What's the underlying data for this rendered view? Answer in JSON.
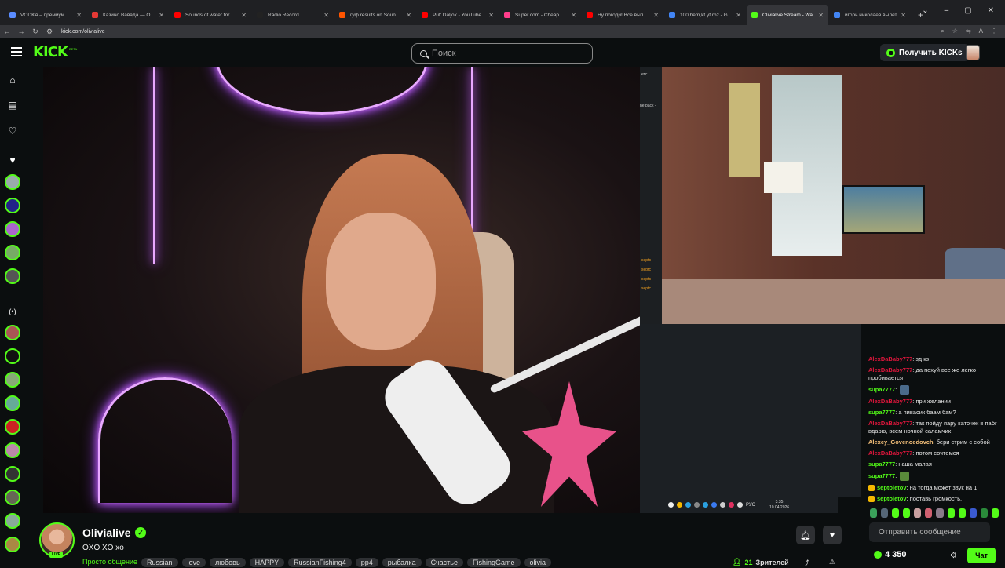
{
  "browser": {
    "tabs": [
      {
        "title": "VODKA – премиум онлайн",
        "color": "#5a8cff"
      },
      {
        "title": "Казино Вавада — Официа",
        "color": "#e53935"
      },
      {
        "title": "Sounds of water for a chi",
        "color": "#ff0000"
      },
      {
        "title": "Radio Record",
        "color": "#222222"
      },
      {
        "title": "гуф results on SoundClou",
        "color": "#ff5500"
      },
      {
        "title": "Put' Daljok - YouTube",
        "color": "#ff0000"
      },
      {
        "title": "Super.com - Cheap hotel",
        "color": "#ff3d8b"
      },
      {
        "title": "Ну погоди! Все выпуски",
        "color": "#ff0000"
      },
      {
        "title": "100 hem,kt yf rbz - Goog",
        "color": "#4285f4"
      },
      {
        "title": "Olivialive Stream - Wa",
        "color": "#53fc18"
      },
      {
        "title": "игорь николаев вылет",
        "color": "#4285f4"
      }
    ],
    "active_tab_index": 9,
    "url": "kick.com/olivialive",
    "new_tab": "+",
    "window_controls": [
      "⌄",
      "–",
      "▢",
      "✕"
    ]
  },
  "header": {
    "logo": "KICK",
    "beta": "BETA",
    "search_placeholder": "Поиск",
    "kicks_button": "Получить KICKs"
  },
  "chat": {
    "messages": [
      {
        "user": "AlexDaBaby777",
        "text": ": зд кз",
        "color": "#e0163c"
      },
      {
        "user": "AlexDaBaby777",
        "text": ": да похуй все же легко пробивается",
        "color": "#e0163c"
      },
      {
        "user": "supa7777",
        "text": ": ",
        "color": "#53fc18",
        "emote": "#4a6a8a"
      },
      {
        "user": "AlexDaBaby777",
        "text": ": при желании",
        "color": "#e0163c"
      },
      {
        "user": "supa7777",
        "text": ": а пивасик баам бам?",
        "color": "#53fc18"
      },
      {
        "user": "AlexDaBaby777",
        "text": ": так пойду пару каточек в пабг вдарю, всем ночной саламчик",
        "color": "#e0163c"
      },
      {
        "user": "Alexey_Govenoedovch",
        "text": ": бери стрим с собой",
        "color": "#f5c07a"
      },
      {
        "user": "AlexDaBaby777",
        "text": ": потом сочтемся",
        "color": "#e0163c"
      },
      {
        "user": "supa7777",
        "text": ": наша малая",
        "color": "#53fc18"
      },
      {
        "user": "supa7777",
        "text": ": ",
        "color": "#53fc18",
        "emote": "#5a8a3a"
      },
      {
        "user": "septoletov",
        "text": ": на тогда может звук на 1",
        "color": "#53fc18",
        "badge": true
      },
      {
        "user": "septoletov",
        "text": ": поставь громкость.",
        "color": "#53fc18",
        "badge": true
      }
    ],
    "emote_colors": [
      "#3aa05a",
      "#556677",
      "#53fc18",
      "#53fc18",
      "#c9a0a0",
      "#d06070",
      "#8a7a8a",
      "#53fc18",
      "#53fc18",
      "#3a5ad0",
      "#2a8a3a",
      "#53fc18"
    ],
    "input_placeholder": "Отправить сообщение",
    "points": "4 350",
    "chat_button": "Чат"
  },
  "stream_screen": {
    "clock_time": "3:35",
    "clock_date": "10.04.2026",
    "lang": "РУС",
    "side_text_1": "етс",
    "side_text_2": "ne back -",
    "ticker": [
      "septc",
      "septc",
      "septc",
      "septc"
    ]
  },
  "streamer": {
    "name": "Olivialive",
    "live": "LIVE",
    "title": "OXO XO xo",
    "category": "Просто общение",
    "tags": [
      "Russian",
      "love",
      "любовь",
      "HAPPY",
      "RussianFishing4",
      "рр4",
      "рыбалка",
      "Счастье",
      "FishingGame",
      "olivia"
    ],
    "viewers": "21",
    "viewers_label": "Зрителей"
  }
}
